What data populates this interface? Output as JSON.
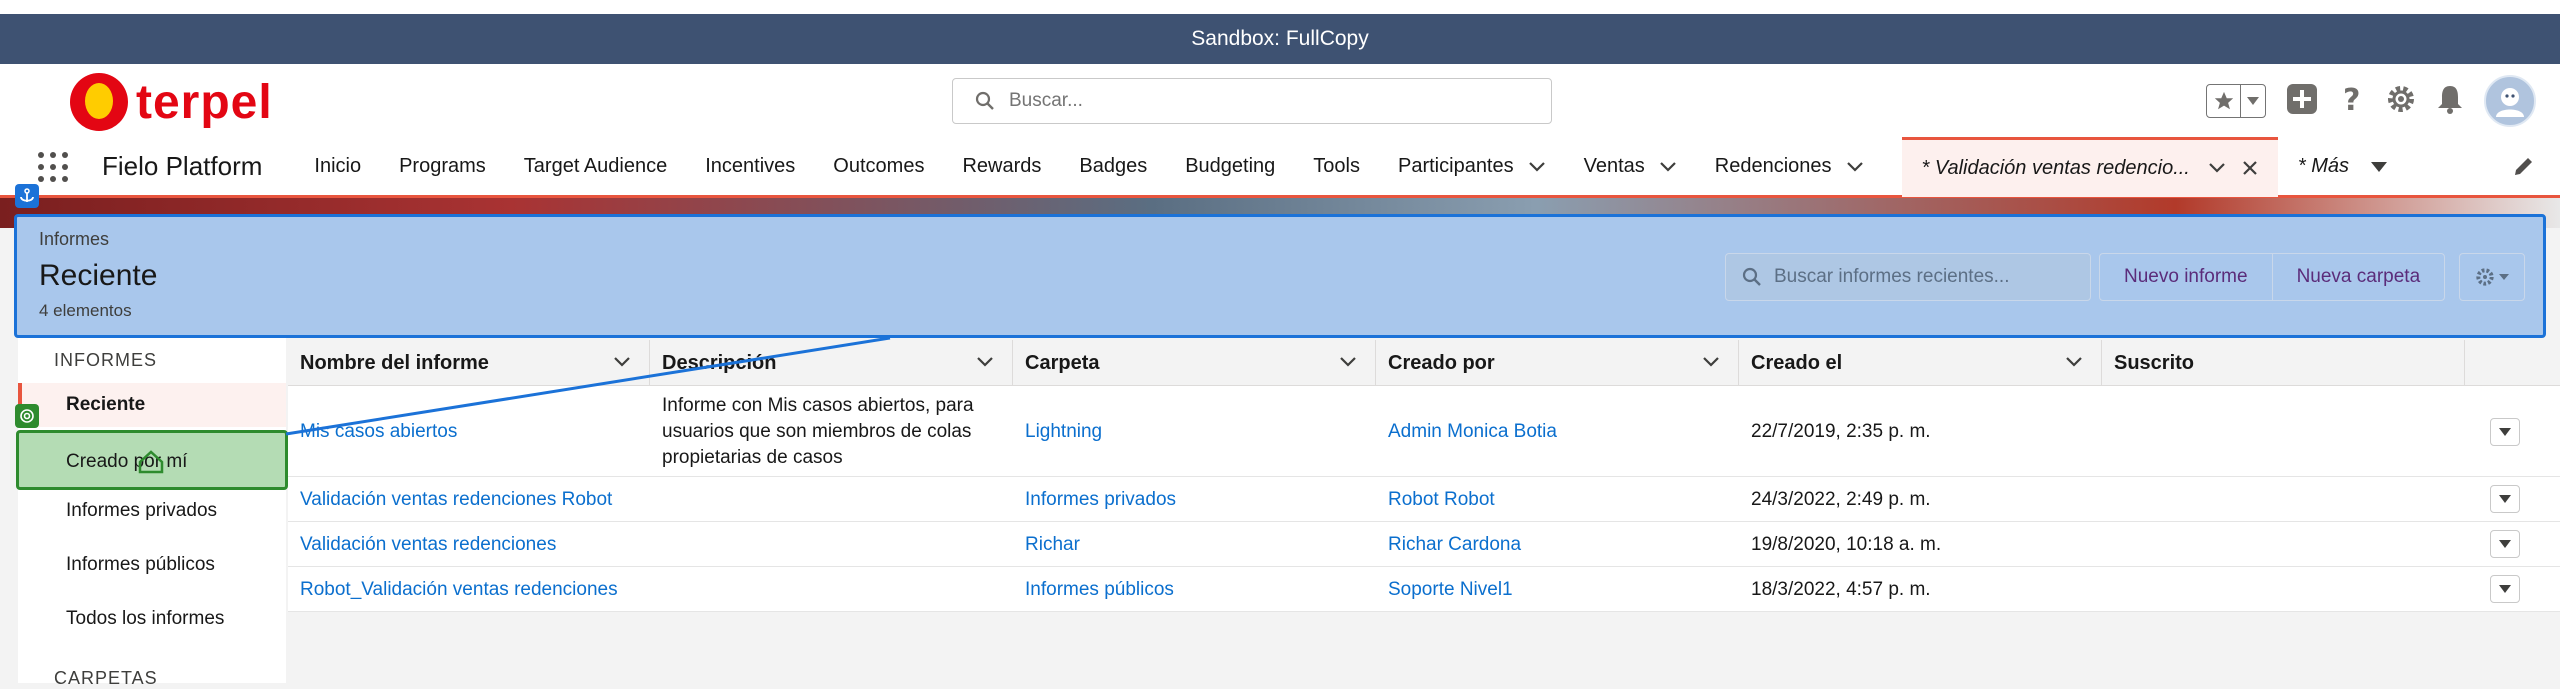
{
  "sandbox": "Sandbox: FullCopy",
  "brand": {
    "logo_text": "terpel",
    "red": "#e30613",
    "yellow": "#ffcc00"
  },
  "header": {
    "search_placeholder": "Buscar..."
  },
  "nav": {
    "app_name": "Fielo Platform",
    "items": [
      "Inicio",
      "Programs",
      "Target Audience",
      "Incentives",
      "Outcomes",
      "Rewards",
      "Badges",
      "Budgeting",
      "Tools"
    ],
    "dropdown_items": [
      "Participantes",
      "Ventas",
      "Redenciones"
    ],
    "active_tab": "* Validación ventas redencio...",
    "more": "* Más"
  },
  "list_header": {
    "object": "Informes",
    "title": "Reciente",
    "count": "4 elementos",
    "search_placeholder": "Buscar informes recientes...",
    "new_report": "Nuevo informe",
    "new_folder": "Nueva carpeta"
  },
  "sidebar": {
    "section_reports": "INFORMES",
    "items": [
      "Reciente",
      "Creado por mí",
      "Informes privados",
      "Informes públicos",
      "Todos los informes"
    ],
    "section_folders": "CARPETAS"
  },
  "table": {
    "columns": [
      "Nombre del informe",
      "Descripción",
      "Carpeta",
      "Creado por",
      "Creado el",
      "Suscrito"
    ],
    "rows": [
      {
        "name": "Mis casos abiertos",
        "description": "Informe con Mis casos abiertos, para usuarios que son miembros de colas propietarias de casos",
        "folder": "Lightning",
        "created_by": "Admin Monica Botia",
        "created_on": "22/7/2019, 2:35 p. m."
      },
      {
        "name": "Validación ventas redenciones Robot",
        "description": "",
        "folder": "Informes privados",
        "created_by": "Robot Robot",
        "created_on": "24/3/2022, 2:49 p. m."
      },
      {
        "name": "Validación ventas redenciones",
        "description": "",
        "folder": "Richar",
        "created_by": "Richar Cardona",
        "created_on": "19/8/2020, 10:18 a. m."
      },
      {
        "name": "Robot_Validación ventas redenciones",
        "description": "",
        "folder": "Informes públicos",
        "created_by": "Soporte Nivel1",
        "created_on": "18/3/2022, 4:57 p. m."
      }
    ]
  },
  "colors": {
    "accent": "#e8553e",
    "link": "#0b6fce",
    "selection_blue": "#1b72d8",
    "selection_green": "#2e8b2e"
  }
}
